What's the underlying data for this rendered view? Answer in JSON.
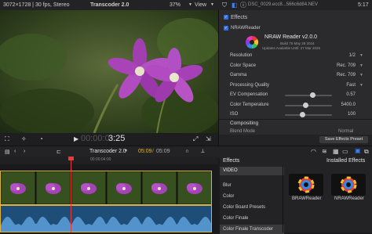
{
  "topbar": {
    "clip_info": "3072×1728 | 30 fps, Stereo",
    "project_title": "Transcoder 2.0",
    "zoom": "37%",
    "view_label": "View",
    "file_name": "DSC_0029.ecc8...566c6d84.NEV",
    "time": "5:17"
  },
  "viewer": {
    "timecode": "00:00:03:25",
    "timecode_dim": "00:00:0",
    "timecode_bright": "3:25"
  },
  "inspector": {
    "effects_header": "Effects",
    "plugin_label": "NRAWReader",
    "plugin_title": "NRAW Reader v2.0.0",
    "build": "Build 75 May 28 2024",
    "updates": "Updates Available Until: 27 Mar 2025",
    "params": [
      {
        "label": "Resolution",
        "value": "1/2"
      },
      {
        "label": "Color Space",
        "value": "Rec. 709"
      },
      {
        "label": "Gamma",
        "value": "Rec. 709"
      },
      {
        "label": "Processing Quality",
        "value": "Fast"
      },
      {
        "label": "EV Compensation",
        "value": "0.57",
        "slider": 0.58
      },
      {
        "label": "Color Temperature",
        "value": "5400.0",
        "slider": 0.44
      },
      {
        "label": "ISO",
        "value": "100",
        "slider": 0.36
      }
    ],
    "compositing": "Compositing",
    "blend_label": "Blend Mode",
    "blend_value": "Normal",
    "save_button": "Save Effects Preset"
  },
  "timeline": {
    "project": "Transcoder 2.0",
    "time_current": "05:09",
    "time_sep": "/",
    "time_total": "05:09",
    "ruler_mark": "00:00:04:00"
  },
  "effects_browser": {
    "title": "Effects",
    "installed": "Installed Effects",
    "category": "VIDEO",
    "items": [
      "Blur",
      "Color",
      "Color Board Presets",
      "Color Finale",
      "Color Finale Transcoder"
    ],
    "thumbs": [
      "BRAWReader",
      "NRAWReader"
    ]
  },
  "colors": {
    "accent": "#2f6fe8",
    "clip_border": "#e0b43a",
    "audio": "#1e4d78"
  }
}
